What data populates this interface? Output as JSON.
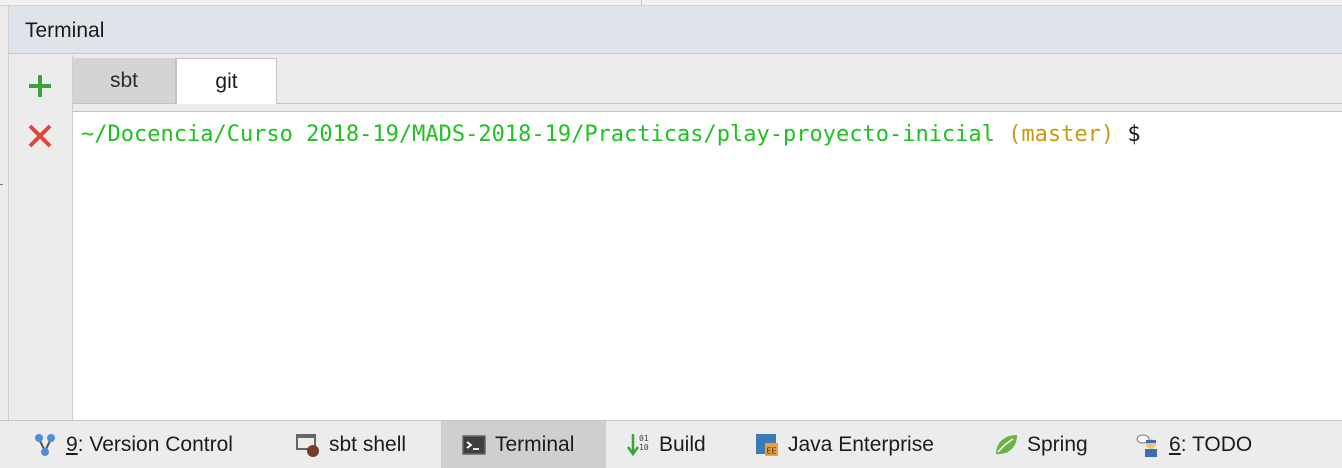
{
  "panel": {
    "title": "Terminal"
  },
  "toolbar": {
    "new_session_icon": "plus-icon",
    "close_session_icon": "close-icon",
    "colors": {
      "plus": "#3aa33a",
      "close": "#e0463a"
    }
  },
  "tabs": [
    {
      "label": "sbt",
      "active": false
    },
    {
      "label": "git",
      "active": true
    }
  ],
  "terminal": {
    "path": "~/Docencia/Curso 2018-19/MADS-2018-19/Practicas/play-proyecto-inicial",
    "branch": "(master)",
    "prompt_symbol": "$",
    "colors": {
      "path": "#1fc11f",
      "branch": "#c79a10",
      "symbol": "#1a1a1a"
    }
  },
  "statusbar": {
    "items": [
      {
        "mnemonic": "9",
        "label": ": Version Control",
        "icon": "version-control-icon"
      },
      {
        "mnemonic": "",
        "label": "sbt shell",
        "icon": "sbt-shell-icon"
      },
      {
        "mnemonic": "",
        "label": "Terminal",
        "icon": "terminal-icon",
        "active": true
      },
      {
        "mnemonic": "",
        "label": "Build",
        "icon": "build-icon"
      },
      {
        "mnemonic": "",
        "label": "Java Enterprise",
        "icon": "java-enterprise-icon"
      },
      {
        "mnemonic": "",
        "label": "Spring",
        "icon": "spring-icon"
      },
      {
        "mnemonic": "6",
        "label": ": TODO",
        "icon": "todo-icon"
      }
    ]
  }
}
